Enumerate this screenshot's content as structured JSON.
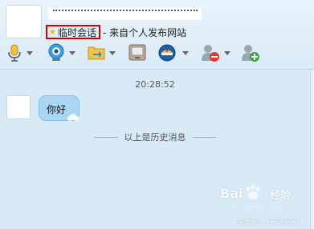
{
  "header": {
    "contact_name": "",
    "temp_session_label": "临时会话",
    "temp_session_source": "- 来自个人发布网站"
  },
  "toolbar": {
    "icons": [
      "microphone-icon",
      "video-camera-icon",
      "file-transfer-icon",
      "remote-desktop-icon",
      "app-center-icon",
      "remove-contact-icon",
      "add-contact-icon"
    ]
  },
  "chat": {
    "timestamp": "20:28:52",
    "messages": [
      {
        "text": "你好"
      }
    ],
    "history_divider": "以上是历史消息"
  },
  "watermark": {
    "brand": "Bai",
    "brand_suffix": "经验",
    "url": "jingyan.baidu.com",
    "author": "头条号 / 天马行空"
  },
  "colors": {
    "background": "#d6e8f6",
    "bubble": "#a9d6f4",
    "highlight_box": "#d40000"
  }
}
